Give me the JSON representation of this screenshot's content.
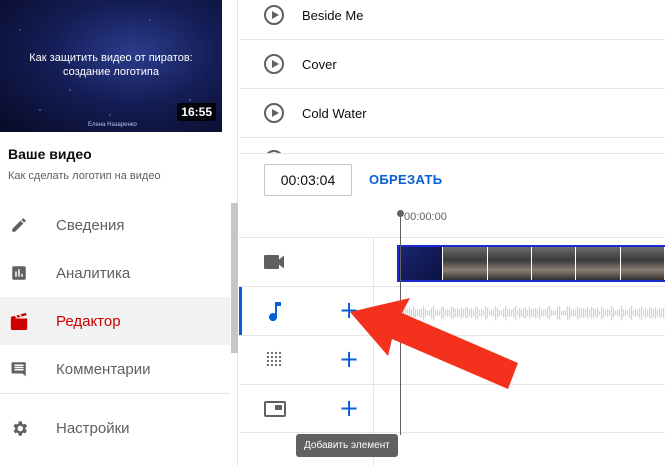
{
  "video": {
    "thumbnail_caption": "Как защитить видео от пиратов: создание логотипа",
    "author": "Елена Назаренко",
    "duration": "16:55",
    "section_label": "Ваше видео",
    "title": "Как сделать логотип на видео"
  },
  "nav": {
    "items": [
      {
        "label": "Сведения",
        "icon": "pencil-icon"
      },
      {
        "label": "Аналитика",
        "icon": "analytics-icon"
      },
      {
        "label": "Редактор",
        "icon": "clapperboard-icon"
      },
      {
        "label": "Комментарии",
        "icon": "comment-icon"
      },
      {
        "label": "Настройки",
        "icon": "gear-icon"
      }
    ],
    "active": "Редактор"
  },
  "music": {
    "tracks": [
      "Beside Me",
      "Cover",
      "Cold Water"
    ]
  },
  "editor": {
    "time_value": "00:03:04",
    "trim_label": "ОБРЕЗАТЬ",
    "timestamp": "00:00:00",
    "add_tooltip": "Добавить элемент",
    "add_symbol": "+"
  },
  "colors": {
    "accent": "#065fd4",
    "active_red": "#cc0000",
    "arrow": "#f4311c"
  }
}
